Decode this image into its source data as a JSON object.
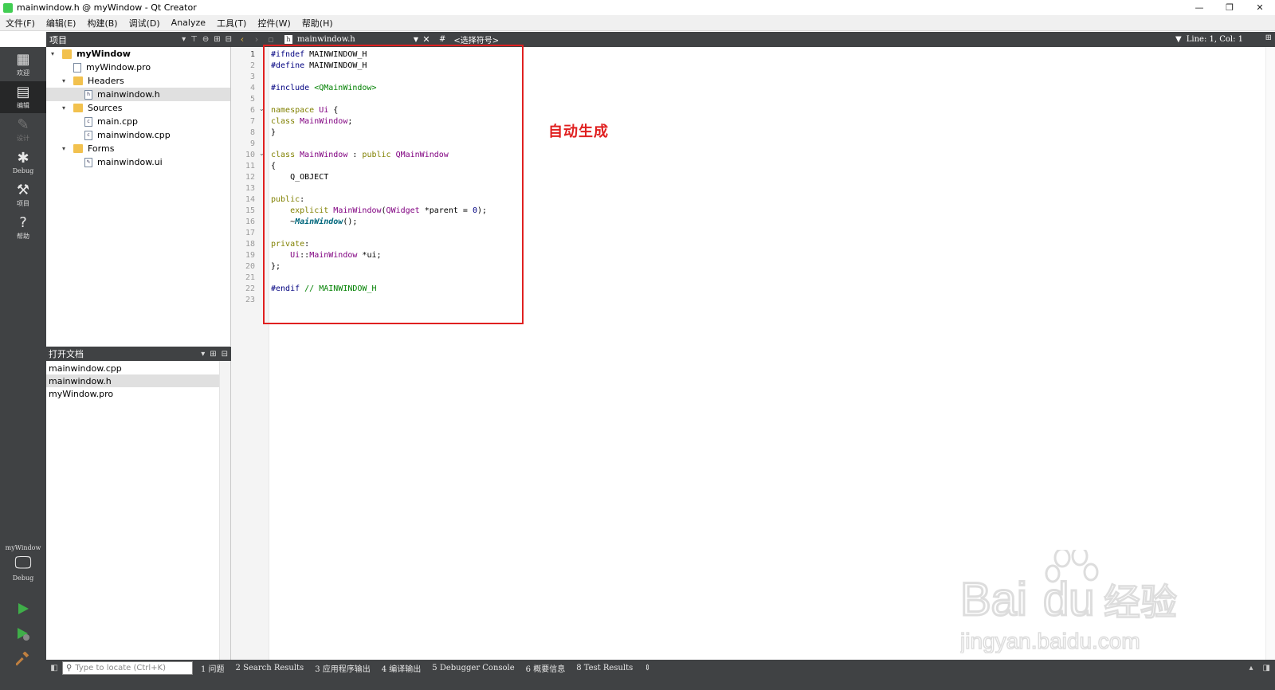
{
  "window": {
    "title": "mainwindow.h @ myWindow - Qt Creator",
    "controls": [
      "—",
      "❐",
      "✕"
    ]
  },
  "menu": [
    "文件(F)",
    "编辑(E)",
    "构建(B)",
    "调试(D)",
    "Analyze",
    "工具(T)",
    "控件(W)",
    "帮助(H)"
  ],
  "project_pane": {
    "label": "项目"
  },
  "editor_toolbar": {
    "file": "mainwindow.h",
    "symbol_hash": "#",
    "symbol": "<选择符号>",
    "line_col": "Line: 1, Col: 1"
  },
  "modes": [
    {
      "label": "欢迎",
      "icon": "grid-icon"
    },
    {
      "label": "编辑",
      "icon": "edit-icon"
    },
    {
      "label": "设计",
      "icon": "pencil-icon"
    },
    {
      "label": "Debug",
      "icon": "bug-icon"
    },
    {
      "label": "项目",
      "icon": "wrench-icon"
    },
    {
      "label": "帮助",
      "icon": "help-icon"
    }
  ],
  "target": {
    "project": "myWindow",
    "config": "Debug"
  },
  "tree": [
    {
      "label": "myWindow",
      "type": "project",
      "depth": 0,
      "expanded": true
    },
    {
      "label": "myWindow.pro",
      "type": "file",
      "depth": 1
    },
    {
      "label": "Headers",
      "type": "folder",
      "depth": 1,
      "expanded": true
    },
    {
      "label": "mainwindow.h",
      "type": "file",
      "depth": 2,
      "selected": true
    },
    {
      "label": "Sources",
      "type": "folder",
      "depth": 1,
      "expanded": true
    },
    {
      "label": "main.cpp",
      "type": "file",
      "depth": 2
    },
    {
      "label": "mainwindow.cpp",
      "type": "file",
      "depth": 2
    },
    {
      "label": "Forms",
      "type": "folder",
      "depth": 1,
      "expanded": true
    },
    {
      "label": "mainwindow.ui",
      "type": "file",
      "depth": 2
    }
  ],
  "open_docs": {
    "label": "打开文档",
    "items": [
      "mainwindow.cpp",
      "mainwindow.h",
      "myWindow.pro"
    ],
    "selected_index": 1
  },
  "code": [
    "#ifndef MAINWINDOW_H",
    "#define MAINWINDOW_H",
    "",
    "#include <QMainWindow>",
    "",
    "namespace Ui {",
    "class MainWindow;",
    "}",
    "",
    "class MainWindow : public QMainWindow",
    "{",
    "    Q_OBJECT",
    "",
    "public:",
    "    explicit MainWindow(QWidget *parent = 0);",
    "    ~MainWindow();",
    "",
    "private:",
    "    Ui::MainWindow *ui;",
    "};",
    "",
    "#endif // MAINWINDOW_H",
    ""
  ],
  "annotation": "自动生成",
  "statusbar": {
    "locator_placeholder": "Type to locate (Ctrl+K)",
    "tabs": [
      "1 问题",
      "2 Search Results",
      "3 应用程序输出",
      "4 编译输出",
      "5 Debugger Console",
      "6 概要信息",
      "8 Test Results"
    ]
  },
  "colors": {
    "panel_dark": "#404244",
    "accent_red": "#e02020",
    "run_green": "#3fae49"
  },
  "watermark": {
    "brand": "Bai",
    "brand2": "du",
    "cn": "经验",
    "url": "jingyan.baidu.com"
  }
}
